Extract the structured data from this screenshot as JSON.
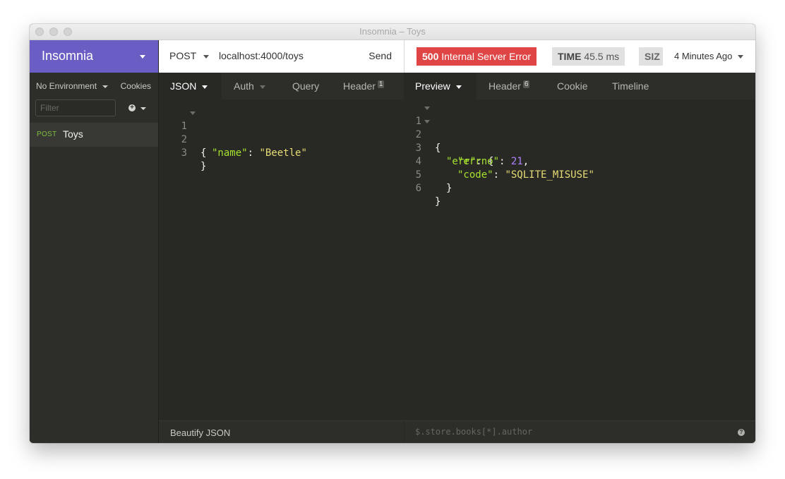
{
  "window": {
    "title": "Insomnia – Toys"
  },
  "sidebar": {
    "brand": "Insomnia",
    "environment": "No Environment",
    "cookies": "Cookies",
    "filter_placeholder": "Filter",
    "add_icon": "+",
    "requests": [
      {
        "method": "POST",
        "name": "Toys"
      }
    ]
  },
  "request": {
    "method": "POST",
    "url": "localhost:4000/toys",
    "send": "Send",
    "tabs": [
      {
        "label": "JSON",
        "active": true
      },
      {
        "label": "Auth"
      },
      {
        "label": "Query"
      },
      {
        "label": "Header",
        "count": "1"
      }
    ],
    "body": [
      {
        "num": "1",
        "text": "{"
      },
      {
        "num": "2",
        "key": "\"name\"",
        "value": "\"Beetle\""
      },
      {
        "num": "3",
        "text": "}"
      }
    ],
    "footer": "Beautify JSON"
  },
  "response": {
    "status_code": "500",
    "status_text": "Internal Server Error",
    "time_label": "TIME",
    "time_value": "45.5 ms",
    "size_label": "SIZ",
    "ago": "4 Minutes Ago",
    "tabs": [
      {
        "label": "Preview",
        "active": true
      },
      {
        "label": "Header",
        "count": "6"
      },
      {
        "label": "Cookie"
      },
      {
        "label": "Timeline"
      }
    ],
    "body": [
      {
        "num": "1",
        "text": "{"
      },
      {
        "num": "2",
        "key": "\"err\"",
        "text": "{"
      },
      {
        "num": "3",
        "key": "\"errno\"",
        "value": "21"
      },
      {
        "num": "4",
        "key": "\"code\"",
        "value": "\"SQLITE_MISUSE\""
      },
      {
        "num": "5",
        "text": "}"
      },
      {
        "num": "6",
        "text": "}"
      }
    ],
    "footer_placeholder": "$.store.books[*].author",
    "help_icon": "?"
  },
  "colors": {
    "brand": "#6a5ec4",
    "status_error": "#e04545",
    "json_key": "#a6e22e",
    "json_string": "#e6db74",
    "json_number": "#ae81ff",
    "method_post": "#7fbf40"
  }
}
